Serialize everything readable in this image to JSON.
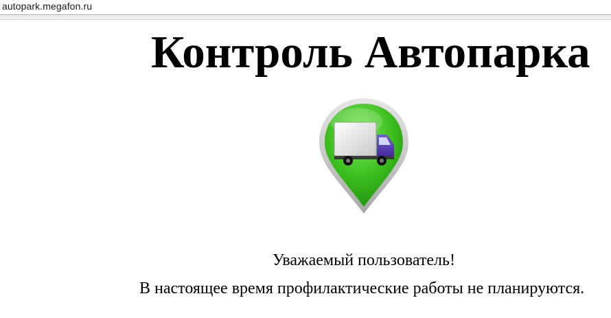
{
  "browser": {
    "url": "autopark.megafon.ru"
  },
  "page": {
    "title": "Контроль Автопарка",
    "logo_icon": "green-map-pin-truck-icon",
    "greeting": "Уважаемый пользователь!",
    "message": "В настоящее время профилактические работы не планируются."
  },
  "colors": {
    "pin_green": "#3cbf1e",
    "pin_border": "#b8b8b8",
    "truck_cab": "#5b3fb5"
  }
}
